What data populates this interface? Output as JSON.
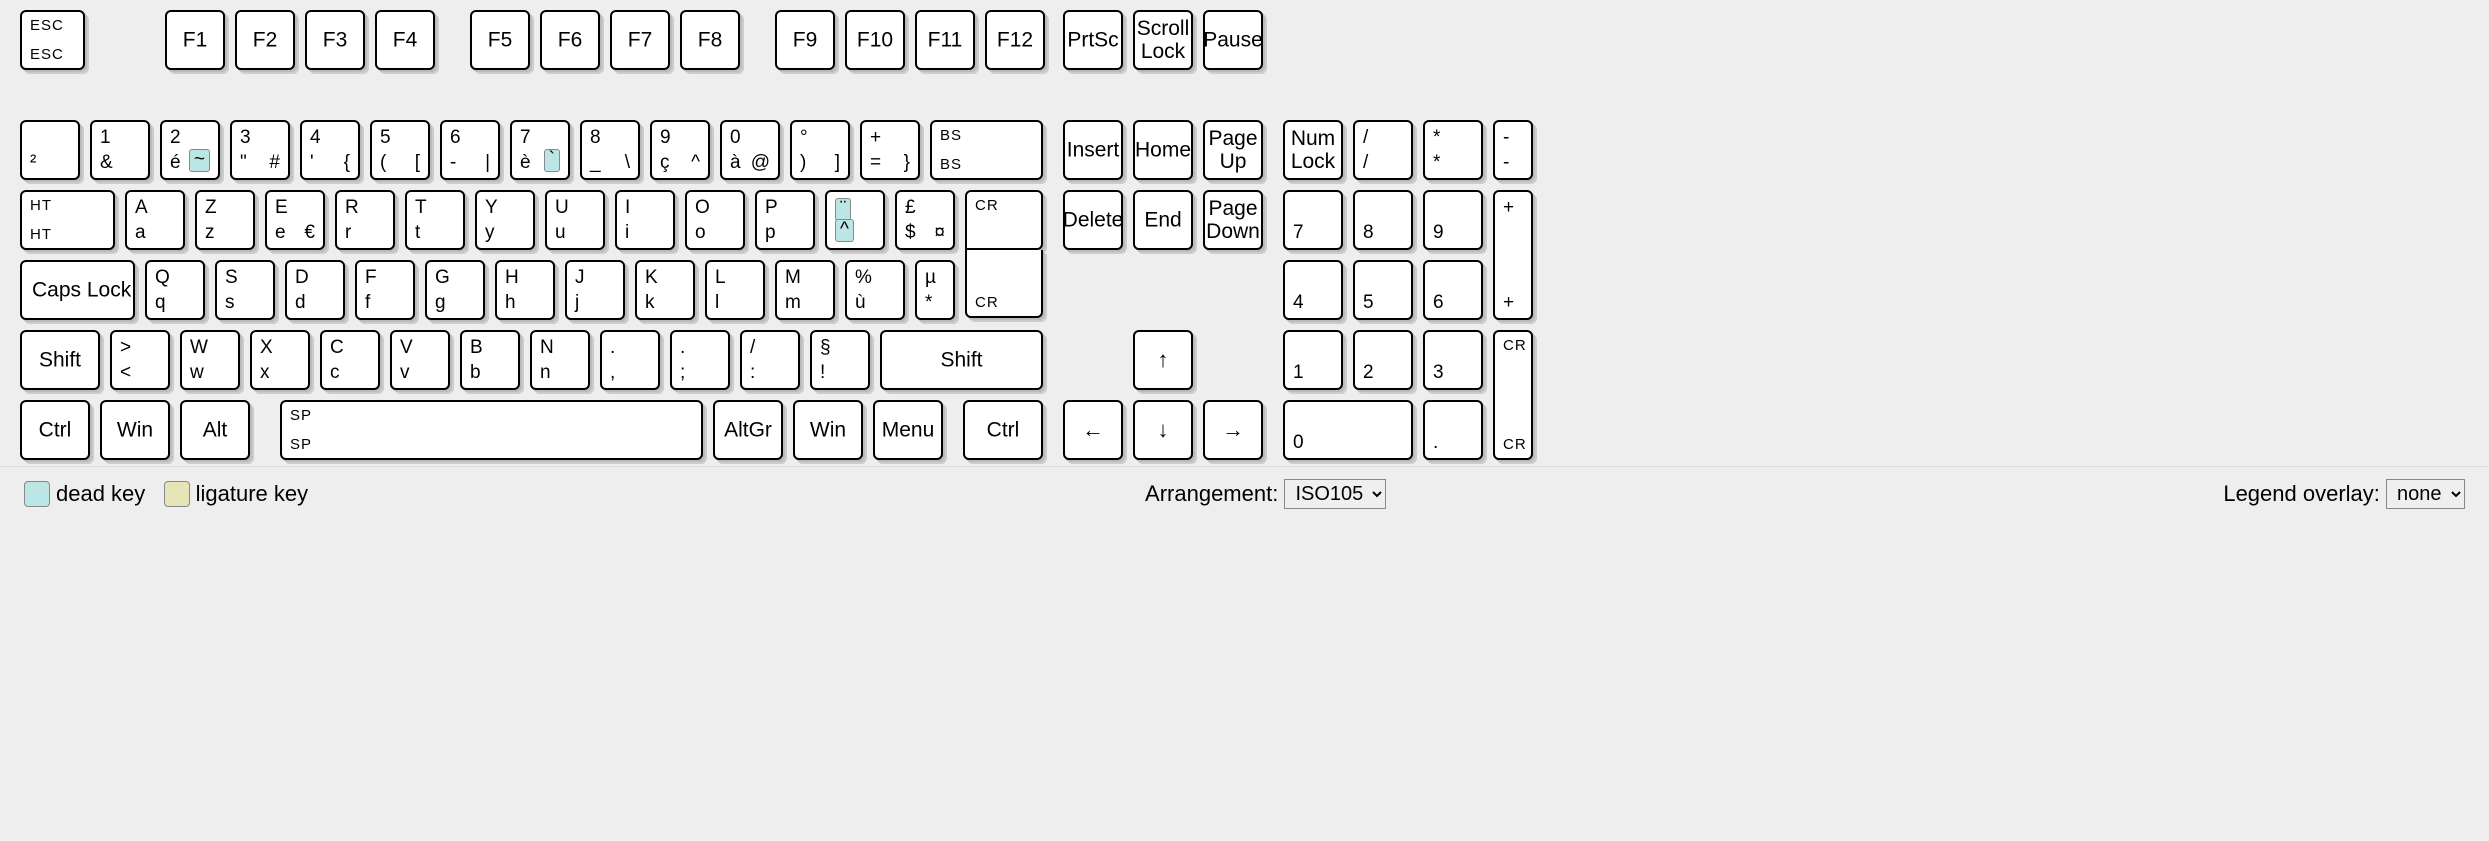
{
  "legend": {
    "dead_key": "dead key",
    "ligature_key": "ligature key"
  },
  "controls": {
    "arrangement_label": "Arrangement:",
    "arrangement_value": "ISO105",
    "legend_overlay_label": "Legend overlay:",
    "legend_overlay_value": "none"
  },
  "row_fn": {
    "esc_tl": "ESC",
    "esc_bl": "ESC",
    "F1": "F1",
    "F2": "F2",
    "F3": "F3",
    "F4": "F4",
    "F5": "F5",
    "F6": "F6",
    "F7": "F7",
    "F8": "F8",
    "F9": "F9",
    "F10": "F10",
    "F11": "F11",
    "F12": "F12",
    "prtsc": "PrtSc",
    "scroll_lock_l1": "Scroll",
    "scroll_lock_l2": "Lock",
    "pause": "Pause"
  },
  "row1": {
    "tilde_bl": "²",
    "k1_tl": "1",
    "k1_bl": "&",
    "k2_tl": "2",
    "k2_bl": "é",
    "k2_dead": "~",
    "k3_tl": "3",
    "k3_bl": "\"",
    "k3_br": "#",
    "k4_tl": "4",
    "k4_bl": "'",
    "k4_br": "{",
    "k5_tl": "5",
    "k5_bl": "(",
    "k5_br": "[",
    "k6_tl": "6",
    "k6_bl": "-",
    "k6_br": "|",
    "k7_tl": "7",
    "k7_bl": "è",
    "k7_dead": "`",
    "k8_tl": "8",
    "k8_bl": "_",
    "k8_br": "\\",
    "k9_tl": "9",
    "k9_bl": "ç",
    "k9_br": "^",
    "k0_tl": "0",
    "k0_bl": "à",
    "k0_br": "@",
    "kmin_tl": "°",
    "kmin_bl": ")",
    "kmin_br": "]",
    "keq_tl": "+",
    "keq_bl": "=",
    "keq_br": "}",
    "bs_tl": "BS",
    "bs_bl": "BS",
    "insert": "Insert",
    "home": "Home",
    "pgup_l1": "Page",
    "pgup_l2": "Up",
    "numlock_l1": "Num",
    "numlock_l2": "Lock",
    "numdiv_tl": "/",
    "numdiv_bl": "/",
    "nummul_tl": "*",
    "nummul_bl": "*",
    "numsub_tl": "-",
    "numsub_bl": "-"
  },
  "row2": {
    "tab_tl": "HT",
    "tab_bl": "HT",
    "A_u": "A",
    "A_l": "a",
    "Z_u": "Z",
    "Z_l": "z",
    "E_u": "E",
    "E_l": "e",
    "E_br": "€",
    "R_u": "R",
    "R_l": "r",
    "T_u": "T",
    "T_l": "t",
    "Y_u": "Y",
    "Y_l": "y",
    "U_u": "U",
    "U_l": "u",
    "I_u": "I",
    "I_l": "i",
    "O_u": "O",
    "O_l": "o",
    "P_u": "P",
    "P_l": "p",
    "dead_top": "¨",
    "dead_bot": "^",
    "dollar_tl": "£",
    "dollar_bl": "$",
    "dollar_br": "¤",
    "enter_tl": "CR",
    "enter_bl": "CR",
    "delete": "Delete",
    "end": "End",
    "pgdn_l1": "Page",
    "pgdn_l2": "Down",
    "num7": "7",
    "num8": "8",
    "num9": "9",
    "numadd": "+"
  },
  "row3": {
    "caps": "Caps Lock",
    "Q_u": "Q",
    "Q_l": "q",
    "S_u": "S",
    "S_l": "s",
    "D_u": "D",
    "D_l": "d",
    "F_u": "F",
    "F_l": "f",
    "G_u": "G",
    "G_l": "g",
    "H_u": "H",
    "H_l": "h",
    "J_u": "J",
    "J_l": "j",
    "K_u": "K",
    "K_l": "k",
    "L_u": "L",
    "L_l": "l",
    "M_u": "M",
    "M_l": "m",
    "pct_tl": "%",
    "pct_bl": "ù",
    "mu_tl": "µ",
    "mu_bl": "*",
    "num4": "4",
    "num5": "5",
    "num6": "6",
    "numadd2": "+"
  },
  "row4": {
    "lshift": "Shift",
    "lt_tl": ">",
    "lt_bl": "<",
    "W_u": "W",
    "W_l": "w",
    "X_u": "X",
    "X_l": "x",
    "C_u": "C",
    "C_l": "c",
    "V_u": "V",
    "V_l": "v",
    "B_u": "B",
    "B_l": "b",
    "N_u": "N",
    "N_l": "n",
    "comma_tl": ".",
    "comma_bl": ",",
    "scolon_tl": ".",
    "scolon_bl": ";",
    "colon_tl": "/",
    "colon_bl": ":",
    "excl_tl": "§",
    "excl_bl": "!",
    "rshift": "Shift",
    "up": "↑",
    "num1": "1",
    "num2": "2",
    "num3": "3",
    "numenter_tl": "CR",
    "numenter_bl": "CR"
  },
  "row5": {
    "lctrl": "Ctrl",
    "lwin": "Win",
    "lalt": "Alt",
    "space_tl": "SP",
    "space_bl": "SP",
    "altgr": "AltGr",
    "rwin": "Win",
    "menu": "Menu",
    "rctrl": "Ctrl",
    "left": "←",
    "down": "↓",
    "right": "→",
    "num0": "0",
    "numdot": ".",
    "numenter_bl": "CR"
  }
}
